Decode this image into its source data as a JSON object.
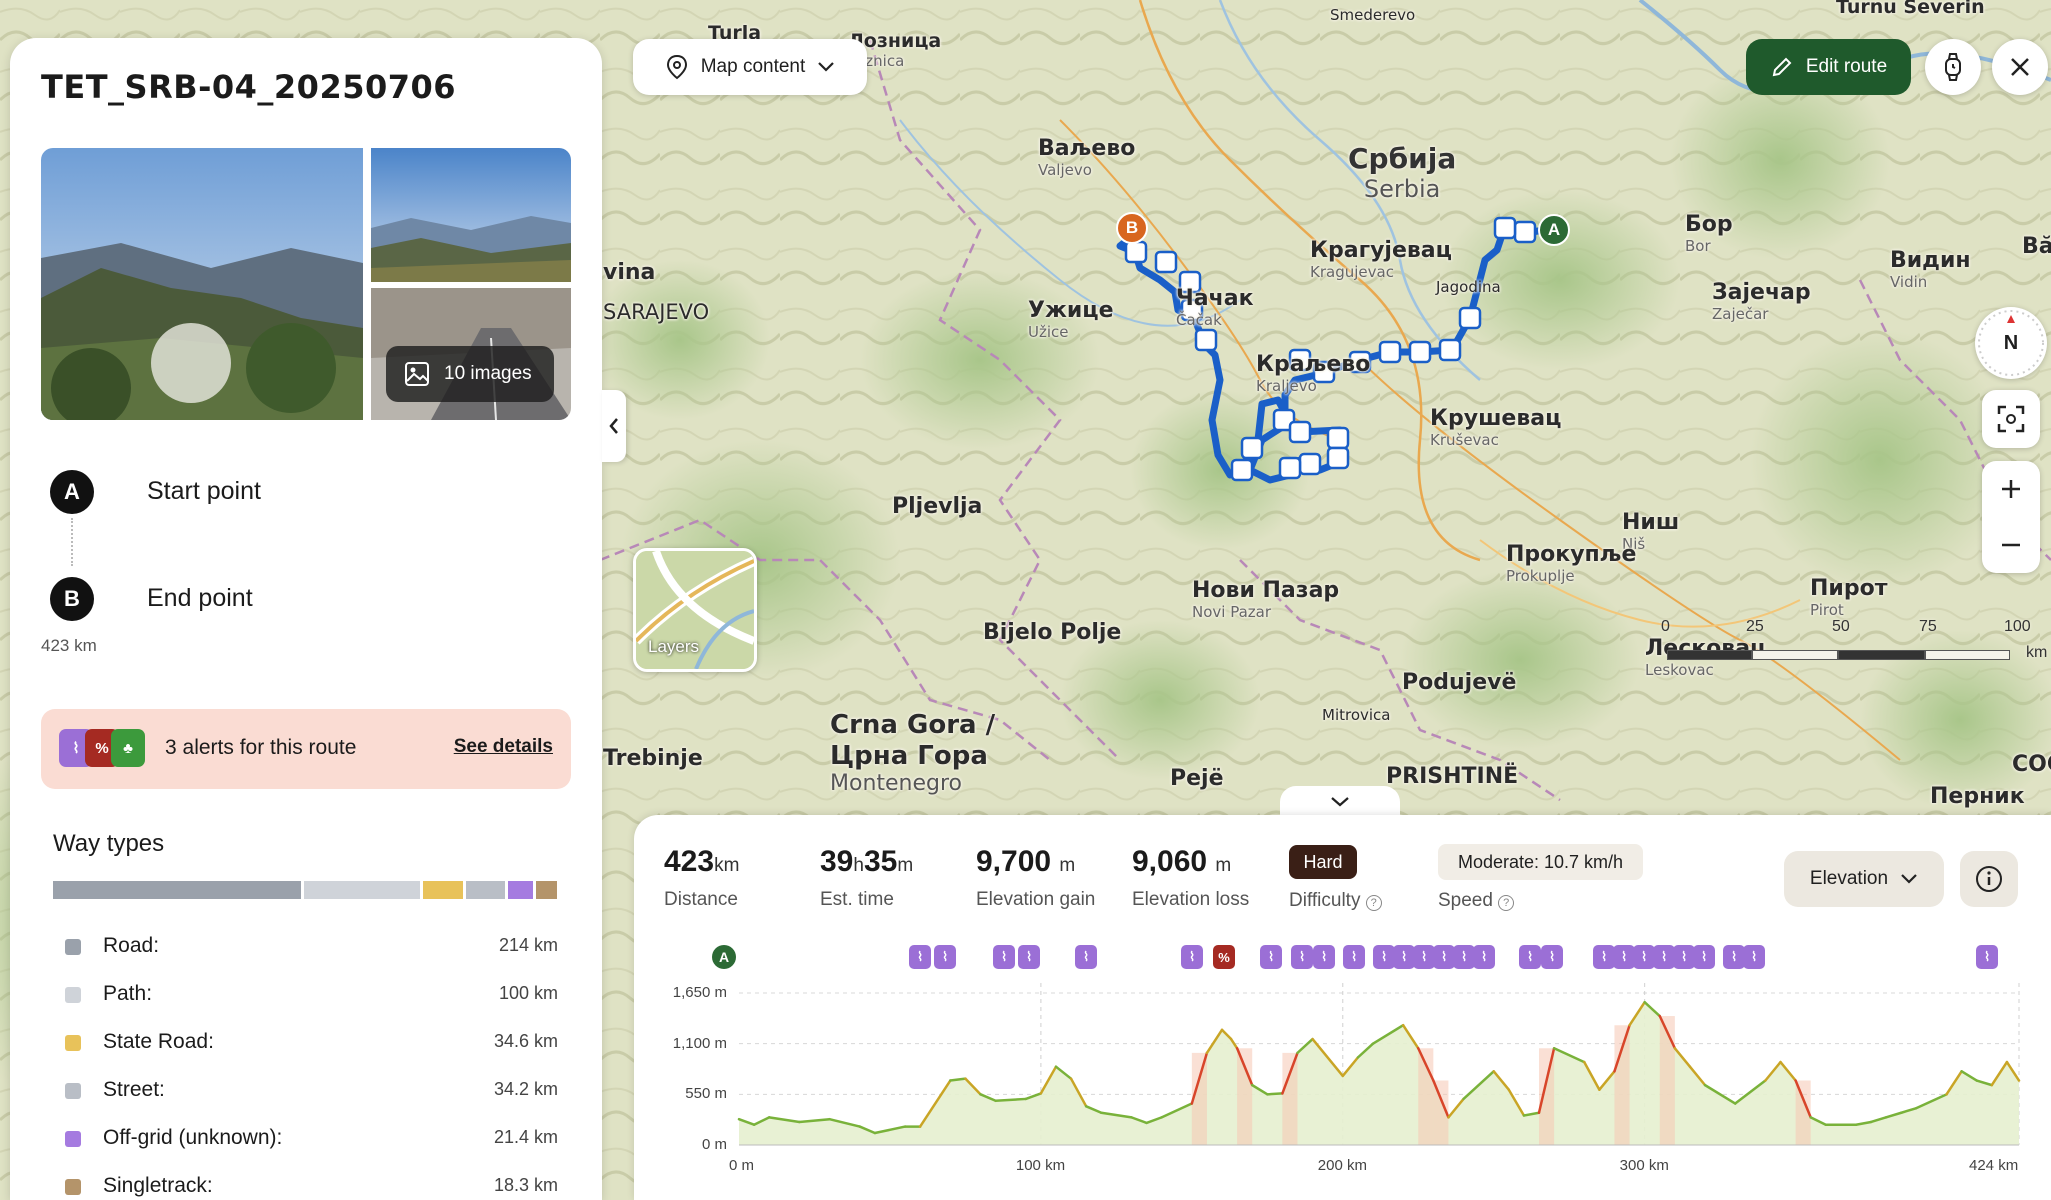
{
  "route": {
    "title": "TET_SRB-04_20250706",
    "images_label": "10 images",
    "start_label": "Start point",
    "start_marker": "A",
    "end_label": "End point",
    "end_marker": "B",
    "total_distance": "423 km"
  },
  "alerts": {
    "text": "3 alerts for this route",
    "link": "See details",
    "icons": [
      {
        "name": "offgrid-alert-icon",
        "color": "#9b6fd6"
      },
      {
        "name": "steep-grade-alert-icon",
        "color": "#a52a22",
        "glyph": "%"
      },
      {
        "name": "nature-reserve-alert-icon",
        "color": "#3c9a3c"
      }
    ]
  },
  "way_types": {
    "title": "Way types",
    "items": [
      {
        "name": "Road:",
        "value": "214 km",
        "color": "#9aa1ab",
        "fraction": 0.506
      },
      {
        "name": "Path:",
        "value": "100 km",
        "color": "#cfd3d9",
        "fraction": 0.236
      },
      {
        "name": "State Road:",
        "value": "34.6 km",
        "color": "#e8c25a",
        "fraction": 0.082
      },
      {
        "name": "Street:",
        "value": "34.2 km",
        "color": "#b9bec6",
        "fraction": 0.081
      },
      {
        "name": "Off-grid (unknown):",
        "value": "21.4 km",
        "color": "#a57be0",
        "fraction": 0.051
      },
      {
        "name": "Singletrack:",
        "value": "18.3 km",
        "color": "#b4946a",
        "fraction": 0.043
      }
    ]
  },
  "map": {
    "content_button": "Map content",
    "edit_button": "Edit route",
    "layers_label": "Layers",
    "compass_label": "N",
    "scale": {
      "ticks": [
        "0",
        "25",
        "50",
        "75",
        "100"
      ],
      "unit": "km"
    },
    "labels": [
      {
        "name": "Turla",
        "sub": ""
      },
      {
        "name": "Лозница",
        "sub": "Loznica"
      },
      {
        "name": "Smederevo",
        "sub": ""
      },
      {
        "name": "Turnu Severin",
        "sub": ""
      },
      {
        "name": "Ваљево",
        "sub": "Valjevo"
      },
      {
        "name": "Србија",
        "sub": "Serbia"
      },
      {
        "name": "Бор",
        "sub": "Bor"
      },
      {
        "name": "Видин",
        "sub": "Vidin"
      },
      {
        "name": "Крагујевац",
        "sub": "Kragujevac"
      },
      {
        "name": "Jagodina",
        "sub": ""
      },
      {
        "name": "Зајечар",
        "sub": "Zaječar"
      },
      {
        "name": "Чачак",
        "sub": "Čačak"
      },
      {
        "name": "Ужице",
        "sub": "Užice"
      },
      {
        "name": "Краљево",
        "sub": "Kraljevo"
      },
      {
        "name": "Крушевац",
        "sub": "Kruševac"
      },
      {
        "name": "vina",
        "sub": ""
      },
      {
        "name": "SARAJEVO",
        "sub": ""
      },
      {
        "name": "Pljevlja",
        "sub": ""
      },
      {
        "name": "Ниш",
        "sub": "Niš"
      },
      {
        "name": "Прокупље",
        "sub": "Prokuplje"
      },
      {
        "name": "Нови Пазар",
        "sub": "Novi Pazar"
      },
      {
        "name": "Пирот",
        "sub": "Pirot"
      },
      {
        "name": "Лесковац",
        "sub": "Leskovac"
      },
      {
        "name": "Bijelo Polje",
        "sub": ""
      },
      {
        "name": "Podujevë",
        "sub": ""
      },
      {
        "name": "Mitrovica",
        "sub": ""
      },
      {
        "name": "Crna Gora /",
        "sub": ""
      },
      {
        "name": "Црна Гора",
        "sub": "Montenegro"
      },
      {
        "name": "Trebinje",
        "sub": ""
      },
      {
        "name": "Pejë",
        "sub": ""
      },
      {
        "name": "PRISHTINË",
        "sub": ""
      },
      {
        "name": "Перник",
        "sub": ""
      },
      {
        "name": "СОС",
        "sub": ""
      },
      {
        "name": "Bă",
        "sub": ""
      }
    ]
  },
  "stats": {
    "distance": {
      "value": "423",
      "unit": "km",
      "label": "Distance"
    },
    "time": {
      "hours": "39",
      "h_unit": "h",
      "minutes": "35",
      "m_unit": "m",
      "label": "Est. time"
    },
    "gain": {
      "value": "9,700",
      "unit": "m",
      "label": "Elevation gain"
    },
    "loss": {
      "value": "9,060",
      "unit": "m",
      "label": "Elevation loss"
    },
    "difficulty": {
      "value": "Hard",
      "label": "Difficulty"
    },
    "speed": {
      "value": "Moderate: 10.7 km/h",
      "label": "Speed"
    },
    "chart_select": "Elevation"
  },
  "chart_data": {
    "type": "area",
    "title": "",
    "xlabel": "",
    "ylabel": "",
    "x_ticks": [
      "0 m",
      "100 km",
      "200 km",
      "300 km",
      "424 km"
    ],
    "y_ticks": [
      "1,650 m",
      "1,100 m",
      "550 m",
      "0 m"
    ],
    "xlim": [
      0,
      424
    ],
    "ylim": [
      0,
      1650
    ],
    "grid": true,
    "series": [
      {
        "x": [
          0,
          5,
          10,
          20,
          30,
          40,
          45,
          55,
          60,
          70,
          75,
          80,
          85,
          95,
          100,
          105,
          110,
          115,
          120,
          130,
          135,
          140,
          150,
          155,
          160,
          163,
          165,
          170,
          175,
          180,
          185,
          190,
          200,
          205,
          210,
          220,
          225,
          230,
          235,
          240,
          250,
          255,
          260,
          265,
          270,
          280,
          285,
          290,
          295,
          300,
          305,
          310,
          315,
          320,
          330,
          340,
          345,
          350,
          355,
          360,
          370,
          375,
          380,
          385,
          390,
          400,
          405,
          410,
          415,
          420,
          424
        ],
        "y": [
          280,
          220,
          300,
          250,
          280,
          200,
          130,
          200,
          200,
          700,
          720,
          550,
          480,
          500,
          560,
          850,
          720,
          420,
          350,
          300,
          240,
          300,
          450,
          1000,
          1250,
          1150,
          1050,
          650,
          550,
          560,
          1000,
          1150,
          750,
          950,
          1100,
          1300,
          1050,
          700,
          300,
          500,
          800,
          600,
          320,
          350,
          1050,
          900,
          600,
          800,
          1300,
          1550,
          1400,
          1050,
          850,
          650,
          450,
          700,
          900,
          700,
          300,
          220,
          220,
          250,
          300,
          350,
          400,
          550,
          800,
          700,
          650,
          900,
          700
        ]
      }
    ]
  },
  "terrain_markers": {
    "start": "A"
  }
}
